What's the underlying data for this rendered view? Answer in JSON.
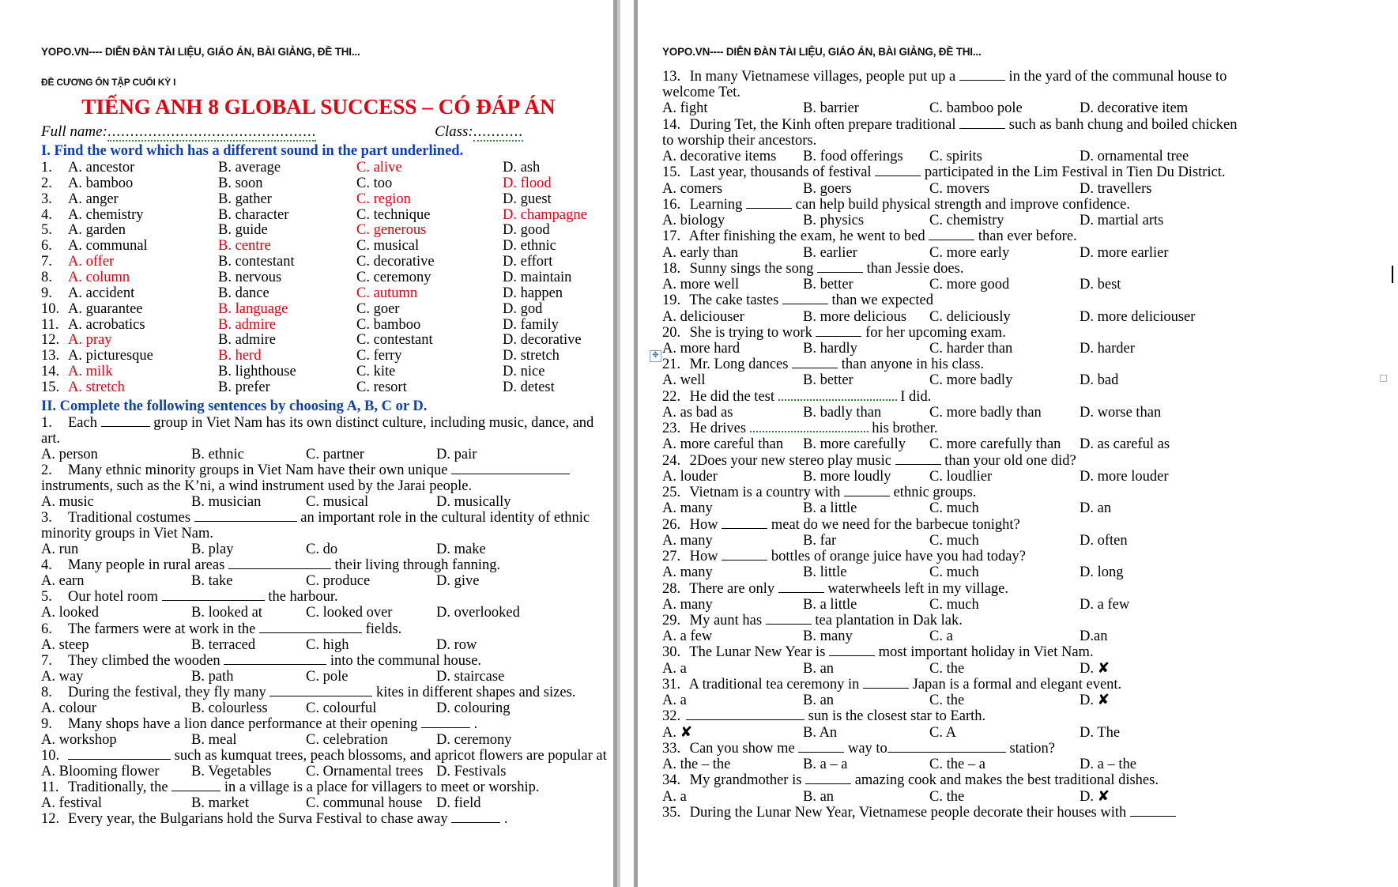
{
  "document": {
    "watermark": "YOPO.VN---- DIỄN ĐÀN TÀI LIỆU, GIÁO ÁN, BÀI GIẢNG, ĐỀ THI...",
    "subheader": "ĐỀ CƯƠNG ÔN TẬP CUỐI KỲ I",
    "title": "TIẾNG ANH 8 GLOBAL SUCCESS – CÓ ĐÁP ÁN",
    "full_name_label": "Full name:",
    "full_name_dots": "..............................................",
    "class_label": "Class:",
    "class_dots": "...........",
    "accent_red": "#e8000d",
    "accent_blue": "#0d3fb5"
  },
  "section_one": {
    "heading": "I.  Find the word which has a different sound in the part underlined.",
    "questions": [
      {
        "n": "1.",
        "a": "A. ancestor",
        "b": "B. average",
        "c": "C. alive",
        "d": "D. ash",
        "answer": "C"
      },
      {
        "n": "2.",
        "a": "A. bamboo",
        "b": "B. soon",
        "c": "C. too",
        "d": "D. flood",
        "answer": "D"
      },
      {
        "n": "3.",
        "a": "A. anger",
        "b": "B. gather",
        "c": "C. region",
        "d": "D. guest",
        "answer": "C"
      },
      {
        "n": "4.",
        "a": "A. chemistry",
        "b": "B. character",
        "c": "C. technique",
        "d": "D. champagne",
        "answer": "D"
      },
      {
        "n": "5.",
        "a": "A. garden",
        "b": "B. guide",
        "c": "C. generous",
        "d": "D. good",
        "answer": "C"
      },
      {
        "n": "6.",
        "a": "A. communal",
        "b": "B. centre",
        "c": "C. musical",
        "d": "D. ethnic",
        "answer": "B"
      },
      {
        "n": "7.",
        "a": "A. offer",
        "b": "B. contestant",
        "c": "C. decorative",
        "d": "D. effort",
        "answer": "A"
      },
      {
        "n": "8.",
        "a": "A. column",
        "b": "B. nervous",
        "c": "C. ceremony",
        "d": "D. maintain",
        "answer": "A"
      },
      {
        "n": "9.",
        "a": "A. accident",
        "b": "B. dance",
        "c": "C. autumn",
        "d": "D. happen",
        "answer": "C"
      },
      {
        "n": "10.",
        "a": "A. guarantee",
        "b": "B. language",
        "c": "C. goer",
        "d": "D. god",
        "answer": "B"
      },
      {
        "n": "11.",
        "a": "A. acrobatics",
        "b": "B. admire",
        "c": "C. bamboo",
        "d": "D. family",
        "answer": "B"
      },
      {
        "n": "12.",
        "a": "A. pray",
        "b": "B. admire",
        "c": "C. contestant",
        "d": "D. decorative",
        "answer": "A"
      },
      {
        "n": "13.",
        "a": "A. picturesque",
        "b": "B. herd",
        "c": "C. ferry",
        "d": "D. stretch",
        "answer": "B"
      },
      {
        "n": "14.",
        "a": "A. milk",
        "b": "B. lighthouse",
        "c": "C. kite",
        "d": "D. nice",
        "answer": "A"
      },
      {
        "n": "15.",
        "a": "A. stretch",
        "b": "B. prefer",
        "c": "C. resort",
        "d": "D. detest",
        "answer": "A"
      }
    ]
  },
  "section_two": {
    "heading": "II. Complete the following sentences by choosing A, B, C or D.",
    "questions": [
      {
        "n": "1.",
        "stem_a": "Each",
        "stem_b": "group in Viet Nam has its own distinct culture, including music, dance, and",
        "stem_wrap": "art.",
        "a": "A. person",
        "b": "B. ethnic",
        "c": "C. partner",
        "d": "D. pair"
      },
      {
        "n": "2.",
        "stem_a": "Many  ethnic  minority  groups  in  Viet  Nam  have  their  own  unique",
        "stem_b": "",
        "stem_wrap": "instruments, such as the K’ni, a wind instrument used by the Jarai people.",
        "a": "A. music",
        "b": "B. musician",
        "c": "C. musical",
        "d": "D. musically"
      },
      {
        "n": "3.",
        "stem_a": "Traditional costumes",
        "stem_b": "an important role in the cultural identity of ethnic",
        "stem_wrap": "minority groups in Viet Nam.",
        "a": "A. run",
        "b": "B. play",
        "c": "C. do",
        "d": "D. make"
      },
      {
        "n": "4.",
        "stem_a": "Many people in rural areas",
        "stem_b": "their living through fanning.",
        "stem_wrap": "",
        "a": "A. earn",
        "b": "B. take",
        "c": "C. produce",
        "d": "D. give"
      },
      {
        "n": "5.",
        "stem_a": "Our hotel room",
        "stem_b": "the harbour.",
        "stem_wrap": "",
        "a": "A. looked",
        "b": "B. looked at",
        "c": "C. looked over",
        "d": "D. overlooked"
      },
      {
        "n": "6.",
        "stem_a": "The farmers were at work in the",
        "stem_b": "fields.",
        "stem_wrap": "",
        "a": "A. steep",
        "b": "B. terraced",
        "c": "C. high",
        "d": "D. row"
      },
      {
        "n": "7.",
        "stem_a": "They climbed the wooden",
        "stem_b": "into the communal house.",
        "stem_wrap": "",
        "a": "A. way",
        "b": "B. path",
        "c": "C. pole",
        "d": "D. staircase"
      },
      {
        "n": "8.",
        "stem_a": "During the festival, they fly many",
        "stem_b": "kites in different shapes and sizes.",
        "stem_wrap": "",
        "a": "A. colour",
        "b": "B. colourless",
        "c": "C. colourful",
        "d": "D. colouring"
      },
      {
        "n": "9.",
        "stem_a": "Many shops have a lion dance performance at their opening",
        "stem_b": ".",
        "stem_wrap": "",
        "a": "A. workshop",
        "b": "B. meal",
        "c": "C. celebration",
        "d": "D. ceremony"
      },
      {
        "n": "10.",
        "stem_a": "",
        "stem_b": "such as kumquat trees, peach blossoms, and apricot flowers are popular at Tet.",
        "stem_wrap": "",
        "a": "A. Blooming flower",
        "b": "B. Vegetables",
        "c": "C. Ornamental trees",
        "d": "D. Festivals"
      },
      {
        "n": "11.",
        "stem_a": "Traditionally, the",
        "stem_b": "in a village is a place for villagers to meet or worship.",
        "stem_wrap": "",
        "a": "A. festival",
        "b": "B. market",
        "c": "C. communal house",
        "d": "D. field"
      },
      {
        "n": "12.",
        "stem_a": "Every year, the Bulgarians hold the Surva Festival to chase away",
        "stem_b": ".",
        "stem_wrap": "",
        "a": "",
        "b": "",
        "c": "",
        "d": ""
      }
    ]
  },
  "section_two_right": {
    "questions": [
      {
        "n": "13.",
        "stem_a": "In many Vietnamese villages,  people put up a",
        "stem_b": "in the yard of the communal house to",
        "stem_wrap": "welcome Tet.",
        "a": "A. fight",
        "b": "B. barrier",
        "c": "C. bamboo pole",
        "d": "D. decorative item"
      },
      {
        "n": "14.",
        "stem_a": "During Tet, the Kinh often prepare traditional",
        "stem_b": "such as banh chung and boiled chicken",
        "stem_wrap": "to worship their ancestors.",
        "a": "A. decorative items",
        "b": "B. food offerings",
        "c": "C. spirits",
        "d": "D.  ornamental tree"
      },
      {
        "n": "15.",
        "stem_a": "Last year, thousands of festival",
        "stem_b": "participated in the Lim Festival in Tien Du District.",
        "stem_wrap": "",
        "a": "A. comers",
        "b": "B. goers",
        "c": "C. movers",
        "d": "D. travellers"
      },
      {
        "n": "16.",
        "stem_a": "Learning",
        "stem_b": "can help build physical strength and improve confidence.",
        "stem_wrap": "",
        "a": "A. biology",
        "b": "B. physics",
        "c": "C. chemistry",
        "d": "D. martial arts"
      },
      {
        "n": "17.",
        "stem_a": "After finishing the exam, he went to bed",
        "stem_b": "than ever before.",
        "stem_wrap": "",
        "a": "A. early than",
        "b": "B. earlier",
        "c": "C. more early",
        "d": "D. more earlier"
      },
      {
        "n": "18.",
        "stem_a": "Sunny sings the song",
        "stem_b": "than Jessie does.",
        "stem_wrap": "",
        "a": "A. more well",
        "b": "B. better",
        "c": "C. more good",
        "d": "D. best"
      },
      {
        "n": "19.",
        "stem_a": "The cake tastes",
        "stem_b": "than we expected",
        "stem_wrap": "",
        "a": "A. deliciouser",
        "b": "B. more delicious",
        "c": "C. deliciously",
        "d": "D. more deliciouser"
      },
      {
        "n": "20.",
        "stem_a": "She is trying to work",
        "stem_b": "for her upcoming exam.",
        "stem_wrap": "",
        "a": "A. more hard",
        "b": "B. hardly",
        "c": "C. harder than",
        "d": "D. harder"
      },
      {
        "n": "21.",
        "stem_a": "Mr. Long dances",
        "stem_b": "than anyone in his class.",
        "stem_wrap": "",
        "a": "A. well",
        "b": "B. better",
        "c": "C.  more badly",
        "d": "D. bad"
      },
      {
        "n": "22.",
        "stem_a": "He did the test",
        "stem_b": "I did.",
        "stem_wrap": "",
        "dotted": true,
        "a": "A. as bad as",
        "b": "B. badly than",
        "c": "C. more badly than",
        "d": "D. worse than"
      },
      {
        "n": "23.",
        "stem_a": "He drives",
        "stem_b": "his brother.",
        "stem_wrap": "",
        "dotted": true,
        "a": "A. more careful than",
        "b": "B. more carefully",
        "c": "C. more carefully than",
        "d": "D. as careful as"
      },
      {
        "n": "24.",
        "stem_a": "2Does your new stereo play music",
        "stem_b": "than your old one did?",
        "stem_wrap": "",
        "a": "A. louder",
        "b": "B. more loudly",
        "c": "C. loudlier",
        "d": "D. more louder"
      },
      {
        "n": "25.",
        "stem_a": "Vietnam is a country with",
        "stem_b": "ethnic groups.",
        "stem_wrap": "",
        "a": "A. many",
        "b": "B.  a little",
        "c": "C. much",
        "d": "D. an"
      },
      {
        "n": "26.",
        "stem_a": "How",
        "stem_b": "meat do we need for the barbecue tonight?",
        "stem_wrap": "",
        "a": "A. many",
        "b": "B.  far",
        "c": "C. much",
        "d": "D. often"
      },
      {
        "n": "27.",
        "stem_a": "How",
        "stem_b": "bottles of orange juice have you had today?",
        "stem_wrap": "",
        "a": "A. many",
        "b": "B.   little",
        "c": "C. much",
        "d": "D.  long"
      },
      {
        "n": "28.",
        "stem_a": "There are only",
        "stem_b": "waterwheels left in my village.",
        "stem_wrap": "",
        "a": "A. many",
        "b": "B.  a little",
        "c": "C. much",
        "d": "D. a few"
      },
      {
        "n": "29.",
        "stem_a": "My aunt has",
        "stem_b": "tea plantation in Dak lak.",
        "stem_wrap": "",
        "a": "A. a few",
        "b": "B. many",
        "c": "C. a",
        "d": "D.an"
      },
      {
        "n": "30.",
        "stem_a": "The Lunar New Year is",
        "stem_b": "most important holiday in Viet Nam.",
        "stem_wrap": "",
        "a": "A. a",
        "b": "B. an",
        "c": "C. the",
        "d": "D. ✘"
      },
      {
        "n": "31.",
        "stem_a": "A traditional tea ceremony in",
        "stem_b": "Japan is a formal and elegant event.",
        "stem_wrap": "",
        "a": "A. a",
        "b": "B. an",
        "c": "C. the",
        "d": "D. ✘"
      },
      {
        "n": "32.",
        "stem_a": "",
        "stem_b": "sun is the closest star to Earth.",
        "stem_wrap": "",
        "a": "A. ✘",
        "b": "B. An",
        "c": "C. A",
        "d": "D. The"
      },
      {
        "n": "33.",
        "stem_a": "Can you show me",
        "stem_b": "way to",
        "stem_c": "station?",
        "stem_wrap": "",
        "a": "A. the – the",
        "b": "B. a – a",
        "c": "C. the – a",
        "d": "D. a – the"
      },
      {
        "n": "34.",
        "stem_a": "My grandmother is",
        "stem_b": "amazing cook and makes the best traditional dishes.",
        "stem_wrap": "",
        "a": "A. a",
        "b": "B. an",
        "c": "C. the",
        "d": "D. ✘"
      },
      {
        "n": "35.",
        "stem_a": "During  the  Lunar  New  Year,  Vietnamese  people  decorate  their  houses  with",
        "stem_b": "",
        "stem_wrap": "",
        "a": "",
        "b": "",
        "c": "",
        "d": ""
      }
    ]
  }
}
